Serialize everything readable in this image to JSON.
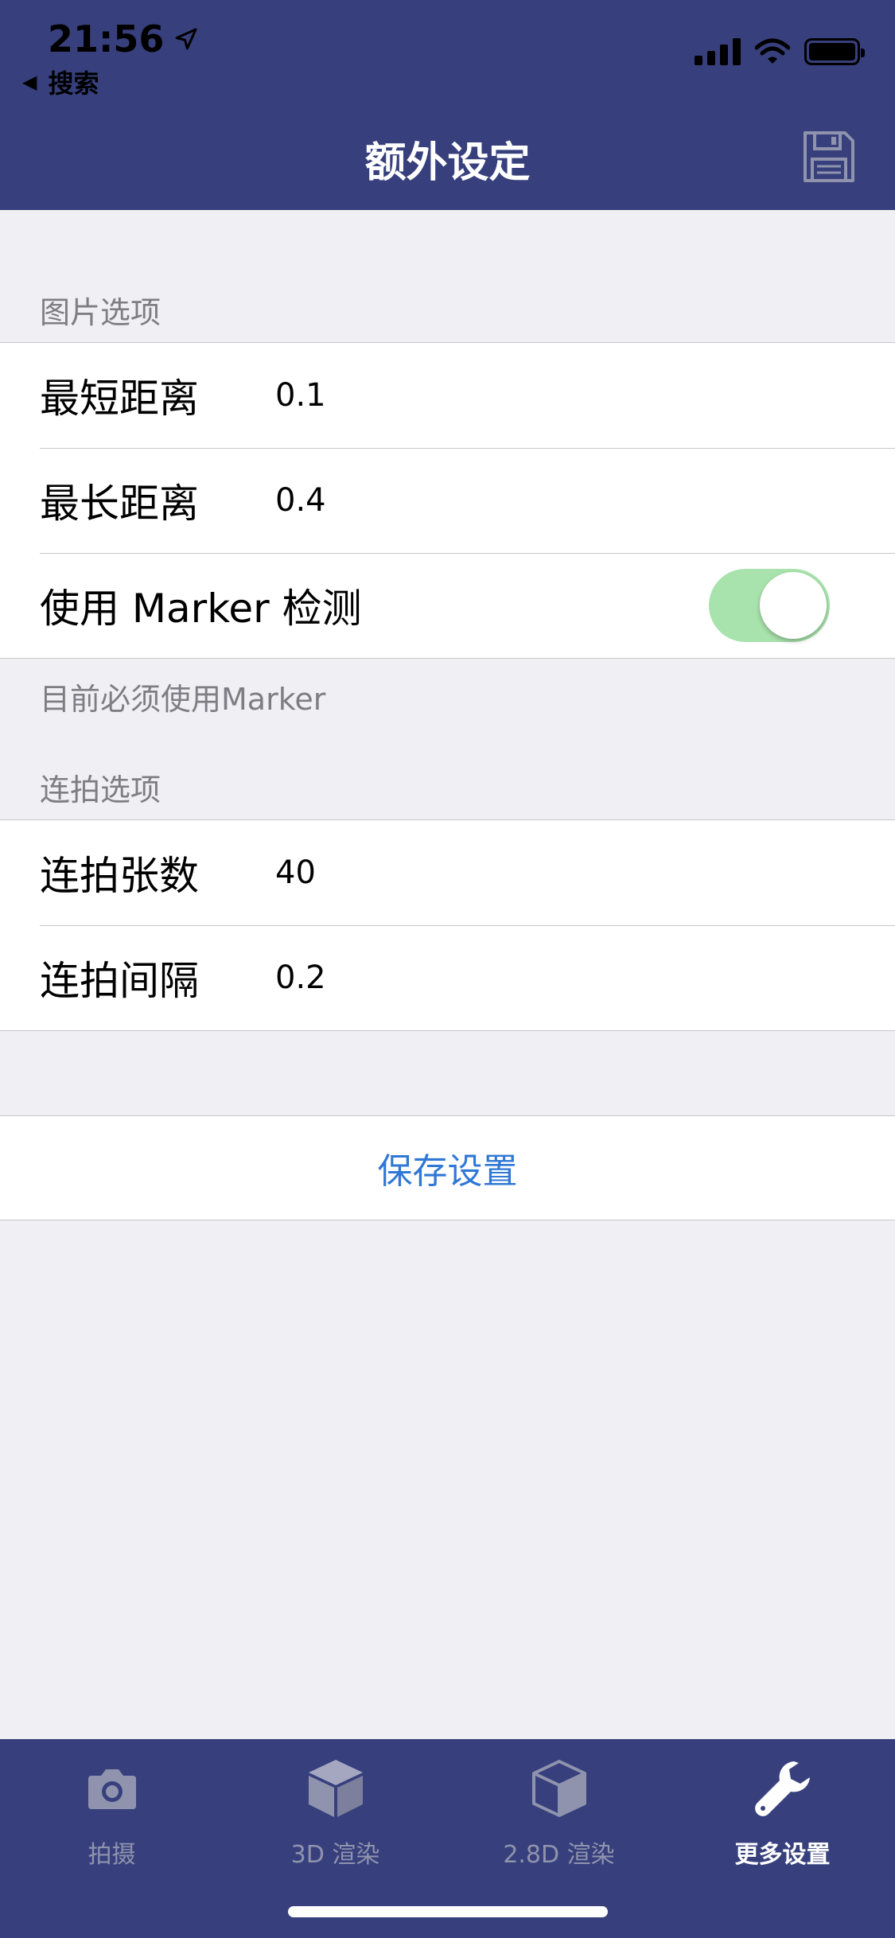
{
  "status_bar": {
    "time": "21:56",
    "back_label": "搜索"
  },
  "nav": {
    "title": "额外设定"
  },
  "image_options": {
    "header": "图片选项",
    "rows": [
      {
        "label": "最短距离",
        "value": "0.1"
      },
      {
        "label": "最长距离",
        "value": "0.4"
      }
    ],
    "marker_toggle": {
      "label": "使用 Marker 检测",
      "on": true
    },
    "footer": "目前必须使用Marker"
  },
  "burst_options": {
    "header": "连拍选项",
    "rows": [
      {
        "label": "连拍张数",
        "value": "40"
      },
      {
        "label": "连拍间隔",
        "value": "0.2"
      }
    ]
  },
  "save_button": {
    "label": "保存设置"
  },
  "tab_bar": {
    "tabs": [
      {
        "label": "拍摄",
        "icon": "camera-icon",
        "active": false
      },
      {
        "label": "3D 渲染",
        "icon": "cube-icon",
        "active": false
      },
      {
        "label": "2.8D 渲染",
        "icon": "cube-outline-icon",
        "active": false
      },
      {
        "label": "更多设置",
        "icon": "wrench-icon",
        "active": true
      }
    ]
  },
  "colors": {
    "nav_background": "#37407d",
    "accent_blue": "#2f78d6",
    "toggle_on": "#a8e2ac",
    "page_background": "#efeff4"
  }
}
